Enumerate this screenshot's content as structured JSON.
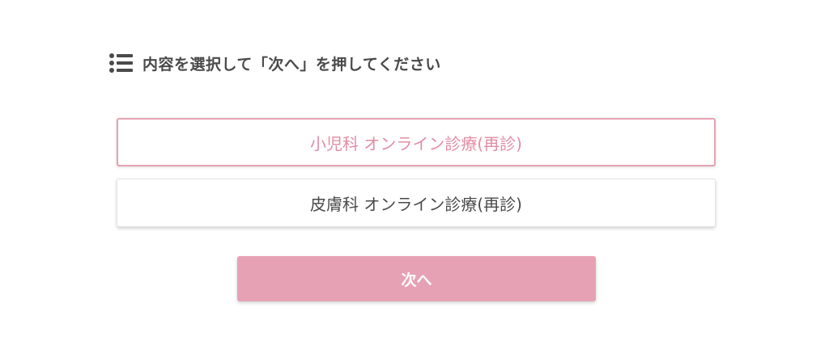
{
  "header": {
    "icon": "list-icon",
    "text": "内容を選択して「次へ」を押してください"
  },
  "options": [
    {
      "label": "小児科 オンライン診療(再診)",
      "selected": true
    },
    {
      "label": "皮膚科 オンライン診療(再診)",
      "selected": false
    }
  ],
  "next_button": {
    "label": "次へ"
  },
  "colors": {
    "accent": "#e6a2b4",
    "accent_text": "#e28ca5",
    "text": "#4a4a4a"
  }
}
